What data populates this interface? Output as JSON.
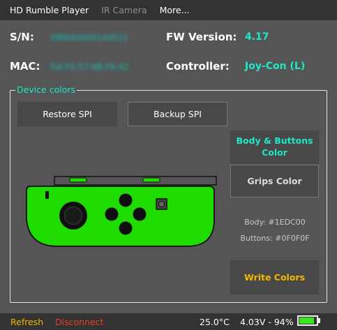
{
  "menu": {
    "items": [
      "HD Rumble Player",
      "IR Camera",
      "More..."
    ]
  },
  "info": {
    "sn_label": "S/N:",
    "sn_value": "XBW40000149521",
    "fw_label": "FW Version:",
    "fw_value": "4.17",
    "mac_label": "MAC:",
    "mac_value": "D4:F0:57:8B:F8:42",
    "controller_label": "Controller:",
    "controller_value": "Joy-Con (L)"
  },
  "device_colors": {
    "title": "Device colors",
    "restore_spi": "Restore SPI",
    "backup_spi": "Backup SPI",
    "body_buttons_color": "Body & Buttons Color",
    "grips_color": "Grips Color",
    "body_info": "Body: #1EDC00",
    "buttons_info": "Buttons: #0F0F0F",
    "write_colors": "Write Colors"
  },
  "controller_colors": {
    "body": "#1EDC00",
    "buttons": "#0F0F0F"
  },
  "status": {
    "refresh": "Refresh",
    "disconnect": "Disconnect",
    "temperature": "25.0°C",
    "battery": "4.03V - 94%",
    "battery_level": 0.94
  },
  "colors": {
    "accent": "#1DE9C8",
    "refresh": "#F0B400",
    "disconnect": "#E8402A",
    "write": "#F5B800"
  }
}
